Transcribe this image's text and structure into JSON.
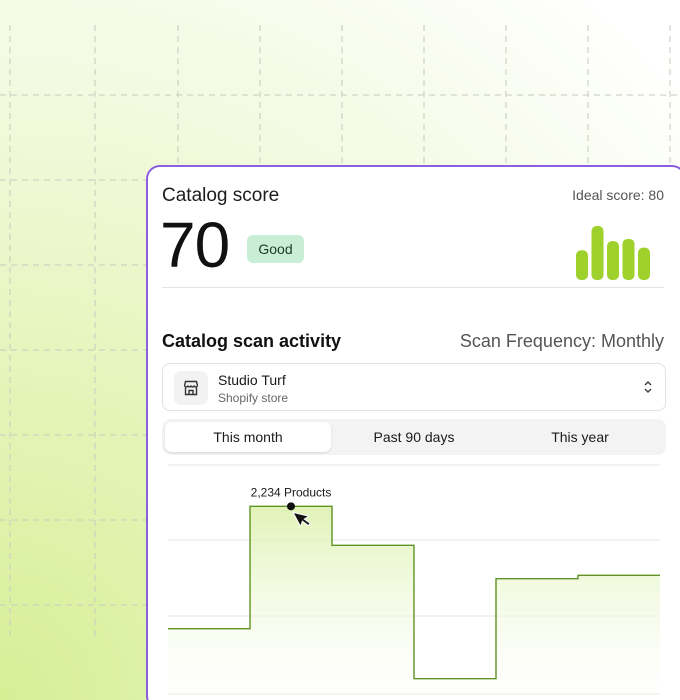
{
  "catalog_score": {
    "title": "Catalog score",
    "ideal_label": "Ideal score: 80",
    "score": "70",
    "badge": "Good",
    "accent_color": "#9fd12c",
    "mini_bars": [
      0.55,
      1.0,
      0.72,
      0.76,
      0.6
    ]
  },
  "scan_activity": {
    "title": "Catalog scan activity",
    "frequency": "Scan Frequency: Monthly",
    "store": {
      "name": "Studio Turf",
      "type": "Shopify store",
      "icon": "storefront-icon"
    },
    "tabs": [
      {
        "label": "This month",
        "active": true
      },
      {
        "label": "Past 90 days",
        "active": false
      },
      {
        "label": "This year",
        "active": false
      }
    ]
  },
  "chart_data": {
    "type": "area",
    "series": [
      {
        "values": [
          1500,
          2234,
          2000,
          1200,
          1800,
          1820
        ]
      }
    ],
    "tooltip": "2,234 Products",
    "highlight_index": 1,
    "ylim": [
      1000,
      2500
    ],
    "grid": true,
    "line_color": "#5f9223"
  }
}
